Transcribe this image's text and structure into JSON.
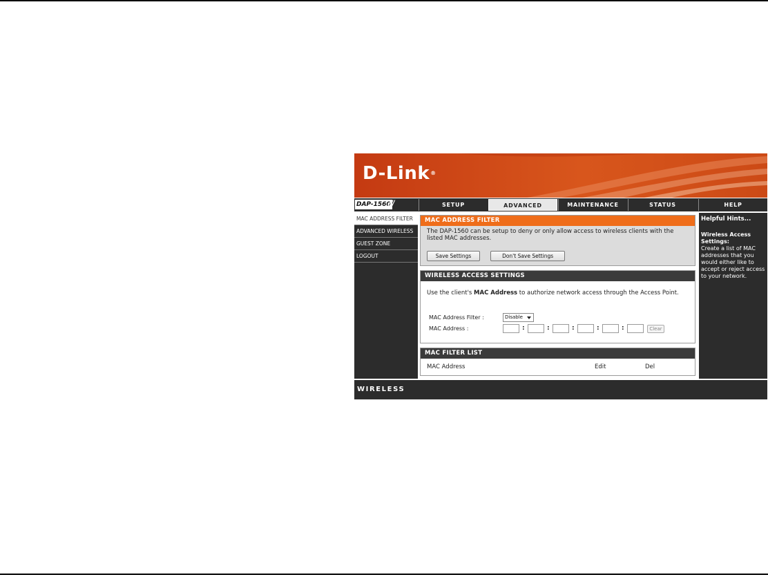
{
  "brand": {
    "logo_text": "D-Link",
    "reg_mark": "®",
    "accent": "#ef6d1a",
    "banner": "#cf4b17",
    "dark": "#2c2c2c"
  },
  "model": {
    "name": "DAP-1560",
    "slashes": "///"
  },
  "tabs": [
    {
      "label": "SETUP"
    },
    {
      "label": "ADVANCED"
    },
    {
      "label": "MAINTENANCE"
    },
    {
      "label": "STATUS"
    },
    {
      "label": "HELP"
    }
  ],
  "sidebar": {
    "items": [
      {
        "label": "MAC ADDRESS FILTER"
      },
      {
        "label": "ADVANCED WIRELESS"
      },
      {
        "label": "GUEST ZONE"
      },
      {
        "label": "LOGOUT"
      }
    ]
  },
  "mac_filter": {
    "title": "MAC ADDRESS FILTER",
    "description": "The DAP-1560 can be setup to deny or only allow access to wireless clients with the listed MAC addresses.",
    "save_label": "Save Settings",
    "dont_save_label": "Don't Save Settings"
  },
  "wireless_access": {
    "title": "WIRELESS ACCESS SETTINGS",
    "desc_pre": "Use the client's ",
    "desc_bold": "MAC Address",
    "desc_post": " to authorize network access through the Access Point.",
    "filter_label": "MAC Address Filter :",
    "filter_value": "Disable",
    "mac_label": "MAC Address :",
    "colon": ":",
    "clear_label": "Clear"
  },
  "filter_list": {
    "title": "MAC FILTER LIST",
    "col_mac": "MAC Address",
    "col_edit": "Edit",
    "col_del": "Del"
  },
  "help": {
    "title": "Helpful Hints...",
    "subtitle": "Wireless Access Settings:",
    "body": "Create a list of MAC addresses that you would either like to accept or reject access to your network."
  },
  "footer": {
    "label": "WIRELESS"
  }
}
